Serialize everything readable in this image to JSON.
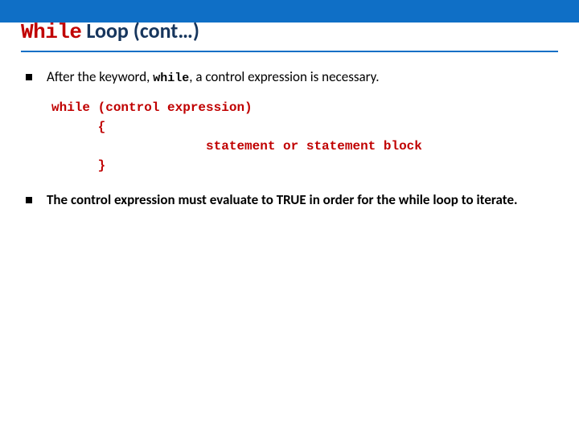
{
  "heading": {
    "keyword": "While",
    "rest": " Loop (cont…)"
  },
  "bullets": {
    "first": {
      "pre": "After the keyword, ",
      "kw": "while",
      "post": ", a control expression is necessary."
    },
    "second": "The control expression must evaluate to TRUE in order for the while loop to iterate."
  },
  "code": "while (control expression)\n      {\n                    statement or statement block\n      }"
}
